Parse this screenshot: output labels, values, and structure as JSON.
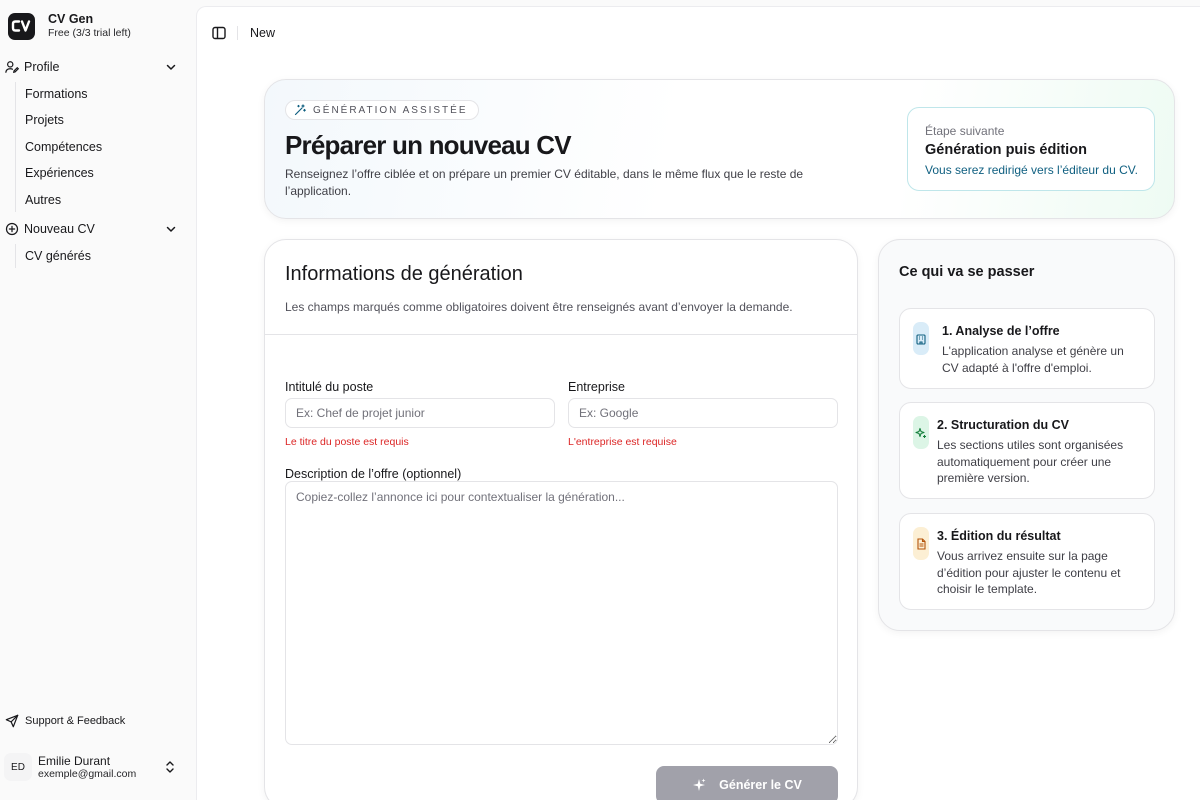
{
  "app": {
    "name": "CV Gen",
    "plan": "Free (3/3 trial left)"
  },
  "sidebar": {
    "groups": [
      {
        "label": "Profile",
        "items": [
          "Formations",
          "Projets",
          "Compétences",
          "Expériences",
          "Autres"
        ]
      },
      {
        "label": "Nouveau CV",
        "items": [
          "CV générés"
        ]
      }
    ],
    "support_label": "Support & Feedback",
    "user": {
      "initials": "ED",
      "name": "Emilie Durant",
      "email": "exemple@gmail.com"
    }
  },
  "topbar": {
    "breadcrumb": "New"
  },
  "hero": {
    "pill": "GÉNÉRATION ASSISTÉE",
    "title": "Préparer un nouveau CV",
    "description": "Renseignez l’offre ciblée et on prépare un premier CV éditable, dans le même flux que le reste de l’application.",
    "next": {
      "label": "Étape suivante",
      "title": "Génération puis édition",
      "description": "Vous serez redirigé vers l’éditeur du CV."
    }
  },
  "form": {
    "title": "Informations de génération",
    "subtitle": "Les champs marqués comme obligatoires doivent être renseignés avant d’envoyer la demande.",
    "job_title": {
      "label": "Intitulé du poste",
      "placeholder": "Ex: Chef de projet junior",
      "value": "",
      "error": "Le titre du poste est requis"
    },
    "company": {
      "label": "Entreprise",
      "placeholder": "Ex: Google",
      "value": "",
      "error": "L'entreprise est requise"
    },
    "description": {
      "label": "Description de l’offre (optionnel)",
      "placeholder": "Copiez-collez l’annonce ici pour contextualiser la génération...",
      "value": ""
    },
    "submit_label": "Générer le CV"
  },
  "steps": {
    "title": "Ce qui va se passer",
    "items": [
      {
        "title": "1. Analyse de l’offre",
        "description": "L'application analyse et génère un CV adapté à l'offre d'emploi.",
        "icon": "building-icon",
        "color": "#d9ecf8"
      },
      {
        "title": "2. Structuration du CV",
        "description": "Les sections utiles sont organisées automatiquement pour créer une première version.",
        "icon": "sparkles-icon",
        "color": "#dcf5e6"
      },
      {
        "title": "3. Édition du résultat",
        "description": "Vous arrivez ensuite sur la page d’édition pour ajuster le contenu et choisir le template.",
        "icon": "document-icon",
        "color": "#fcefd4"
      }
    ]
  },
  "colors": {
    "error": "#dc2626",
    "accent_link": "#0f5f80",
    "button_disabled": "#a1a1aa"
  }
}
